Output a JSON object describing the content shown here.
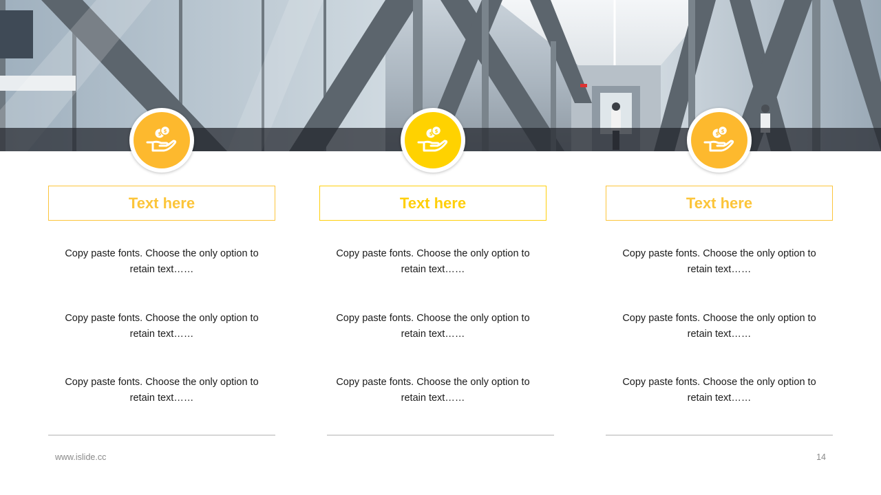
{
  "theme": {
    "accent_orange": "#FDB92E",
    "accent_yellow": "#FFD200",
    "title_orange": "#FCC53A",
    "title_yellow": "#FFCF0A"
  },
  "columns": [
    {
      "icon": "hand-coins-icon",
      "title": "Text here",
      "paragraphs": [
        {
          "line1": "Copy paste fonts. Choose the only option to",
          "line2": "retain text……"
        },
        {
          "line1": "Copy paste fonts. Choose the only option to",
          "line2": "retain text……"
        },
        {
          "line1": "Copy paste fonts. Choose the only option to",
          "line2": "retain text……"
        }
      ]
    },
    {
      "icon": "hand-coins-icon",
      "title": "Text here",
      "paragraphs": [
        {
          "line1": "Copy paste fonts. Choose the only option to",
          "line2": "retain text……"
        },
        {
          "line1": "Copy paste fonts. Choose the only option to",
          "line2": "retain text……"
        },
        {
          "line1": "Copy paste fonts. Choose the only option to",
          "line2": "retain text……"
        }
      ]
    },
    {
      "icon": "hand-coins-icon",
      "title": "Text here",
      "paragraphs": [
        {
          "line1": "Copy paste fonts. Choose the only option to",
          "line2": "retain text……"
        },
        {
          "line1": "Copy paste fonts. Choose the only option to",
          "line2": "retain text……"
        },
        {
          "line1": "Copy paste fonts. Choose the only option to",
          "line2": "retain text……"
        }
      ]
    }
  ],
  "footer": {
    "url": "www.islide.cc",
    "page_number": "14"
  }
}
